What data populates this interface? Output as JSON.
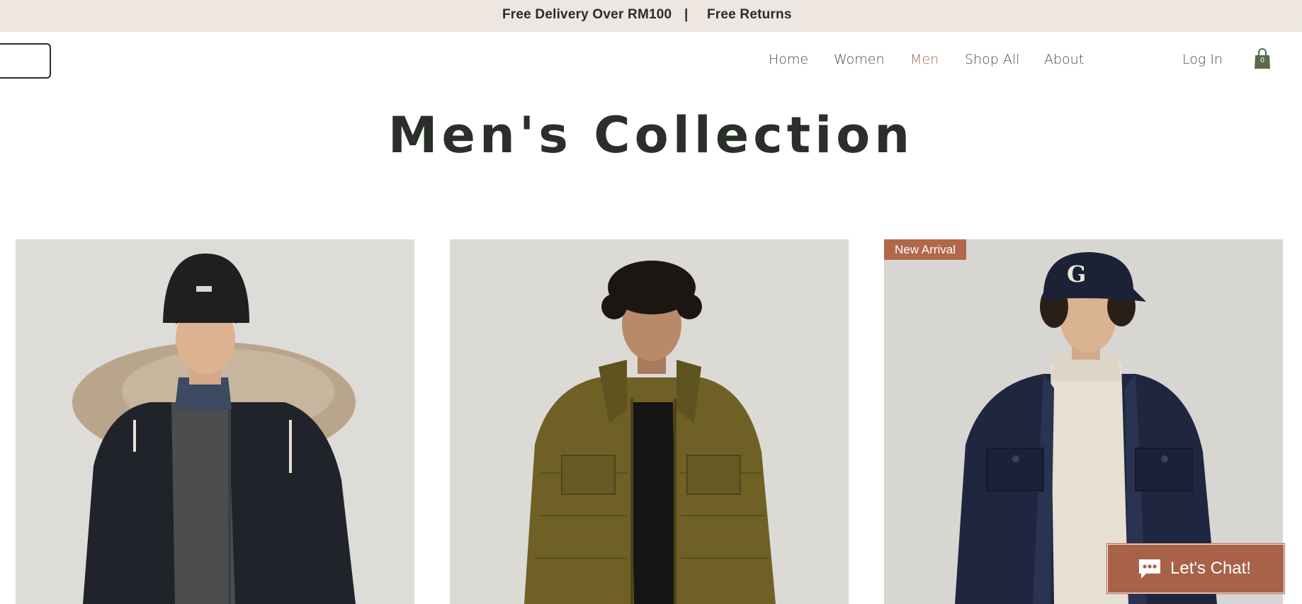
{
  "announcement": {
    "left": "Free Delivery Over RM100",
    "separator": "|",
    "right": "Free Returns"
  },
  "header": {
    "nav": [
      {
        "label": "Home",
        "active": false
      },
      {
        "label": "Women",
        "active": false
      },
      {
        "label": "Men",
        "active": true
      },
      {
        "label": "Shop All",
        "active": false
      },
      {
        "label": "About",
        "active": false
      }
    ],
    "login_label": "Log In",
    "cart_count": "0"
  },
  "page": {
    "title": "Men's Collection"
  },
  "products": [
    {
      "badge": "",
      "image": "man-in-dark-parka-with-fur-hood"
    },
    {
      "badge": "",
      "image": "man-in-olive-puffer-jacket"
    },
    {
      "badge": "New Arrival",
      "image": "man-in-navy-jacket-and-cap"
    }
  ],
  "chat": {
    "label": "Let's Chat!"
  },
  "colors": {
    "announcement_bg": "#ede6e1",
    "accent": "#a8674c",
    "badge_bg": "#b0674a",
    "chat_bg": "#a8624a",
    "title": "#2b2f2a"
  }
}
